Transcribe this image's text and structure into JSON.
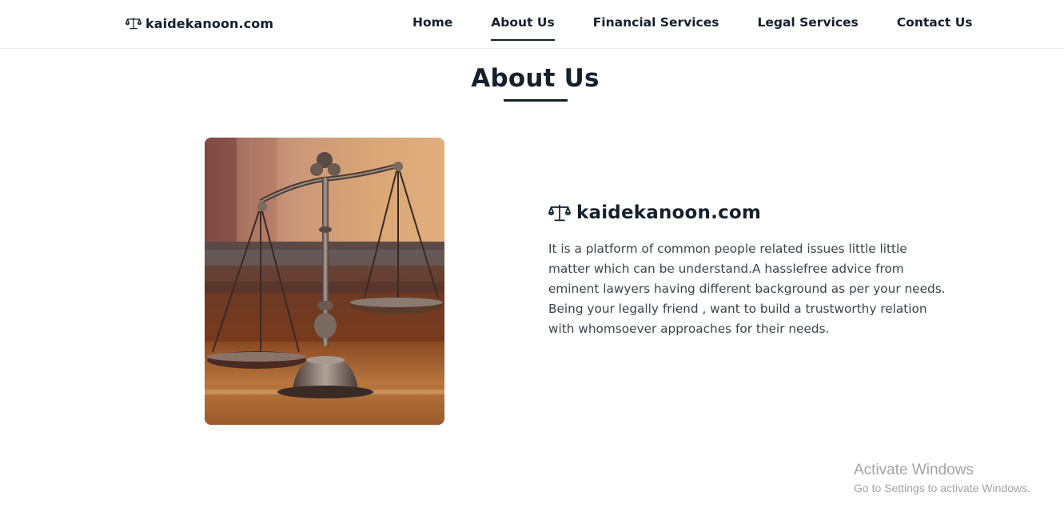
{
  "navbar": {
    "brand": "kaidekanoon.com",
    "brand_icon": "scales-icon",
    "links": [
      {
        "label": "Home",
        "active": false
      },
      {
        "label": "About Us",
        "active": true
      },
      {
        "label": "Financial Services",
        "active": false
      },
      {
        "label": "Legal Services",
        "active": false
      },
      {
        "label": "Contact Us",
        "active": false
      }
    ]
  },
  "section": {
    "title": "About Us"
  },
  "about": {
    "image_subject": "scales-of-justice",
    "brand": "kaidekanoon.com",
    "brand_icon": "scales-icon",
    "paragraph_1": "It is a platform of common people related issues little little matter which can be understand.A hasslefree advice from eminent lawyers having different background as per your needs.",
    "paragraph_2": "Being your legally friend , want to build a trustworthy relation with whomsoever approaches for their needs."
  },
  "watermark": {
    "title": "Activate Windows",
    "subtitle": "Go to Settings to activate Windows."
  },
  "colors": {
    "text_dark": "#14202b",
    "text_body": "#3a444d",
    "watermark": "#a3a3a3"
  }
}
